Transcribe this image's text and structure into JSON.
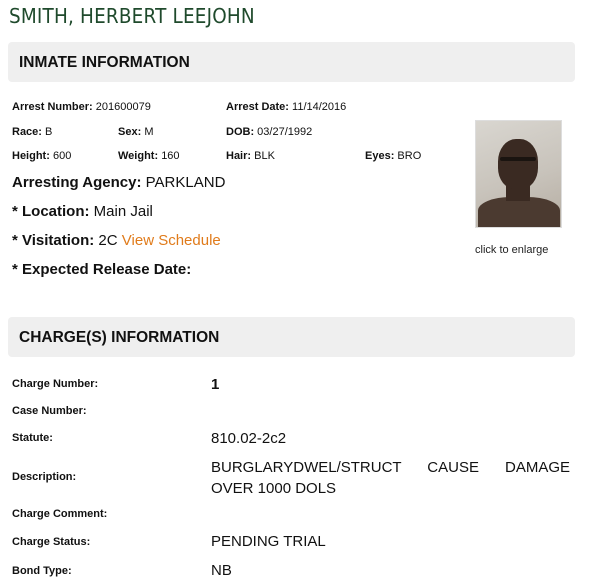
{
  "name": "SMITH, HERBERT LEEJOHN",
  "inmate_section": {
    "title": "INMATE INFORMATION"
  },
  "inmate": {
    "arrest_number_label": "Arrest Number:",
    "arrest_number": "201600079",
    "arrest_date_label": "Arrest Date:",
    "arrest_date": "11/14/2016",
    "race_label": "Race:",
    "race": "B",
    "sex_label": "Sex:",
    "sex": "M",
    "dob_label": "DOB:",
    "dob": "03/27/1992",
    "height_label": "Height:",
    "height": "600",
    "weight_label": "Weight:",
    "weight": "160",
    "hair_label": "Hair:",
    "hair": "BLK",
    "eyes_label": "Eyes:",
    "eyes": "BRO",
    "agency_label": "Arresting Agency:",
    "agency": "PARKLAND",
    "location_label": "* Location:",
    "location": "Main Jail",
    "visitation_label": "* Visitation:",
    "visitation": "2C",
    "view_schedule": "View Schedule",
    "release_label": "* Expected Release Date:",
    "photo_caption": "click to enlarge"
  },
  "charge_section": {
    "title": "CHARGE(S) INFORMATION"
  },
  "charge": {
    "charge_number_label": "Charge Number:",
    "charge_number": "1",
    "case_number_label": "Case Number:",
    "statute_label": "Statute:",
    "statute": "810.02-2c2",
    "description_label": "Description:",
    "description": "BURGLARYDWEL/STRUCT CAUSE DAMAGE OVER 1000 DOLS",
    "comment_label": "Charge Comment:",
    "status_label": "Charge Status:",
    "status": "PENDING TRIAL",
    "bond_type_label": "Bond Type:",
    "bond_type": "NB"
  },
  "colors": {
    "name": "#1f4a2c",
    "link": "#e07b1b",
    "section_bg": "#efefef"
  },
  "icons": {
    "photo": "inmate-photo"
  }
}
